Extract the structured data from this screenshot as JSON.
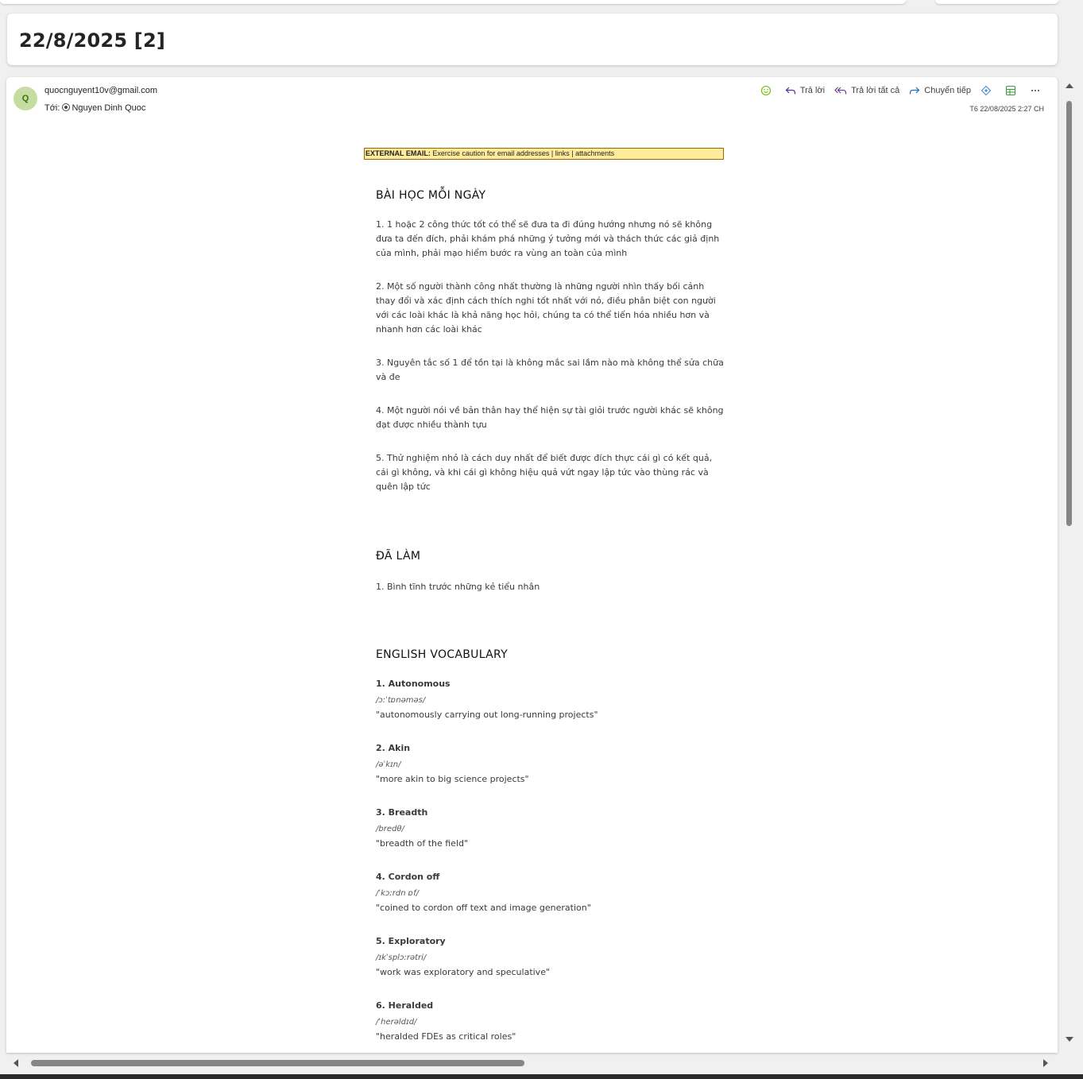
{
  "subject": "22/8/2025 [2]",
  "message": {
    "avatar_initial": "Q",
    "sender": "quocnguyent10v@gmail.com",
    "to_label": "Tới:",
    "to_name": "Nguyen Dinh Quoc",
    "timestamp": "T6 22/08/2025 2:27 CH",
    "actions": {
      "emoji_icon": "smiley-icon",
      "reply": "Trả lời",
      "reply_all": "Trả lời tất cả",
      "forward": "Chuyển tiếp"
    }
  },
  "body": {
    "banner_label": "EXTERNAL EMAIL:",
    "banner_text": " Exercise caution for email addresses | links | attachments",
    "lesson_heading": "BÀI HỌC MỖI NGÀY",
    "lessons": [
      "1. 1 hoặc 2 công thức tốt có thể sẽ đưa ta đi đúng hướng nhưng nó sẽ không đưa ta đến đích, phải khám phá những ý tưởng mới và thách thức các giả định của mình, phải mạo hiểm bước ra vùng an toàn của mình",
      "2. Một số người thành công nhất thường là những người nhìn thấy bối cảnh thay đổi và xác định cách thích nghi tốt nhất với nó, điều phân biệt con người với các loài khác là khả năng học hỏi, chúng ta có thể tiến hóa nhiều hơn và nhanh hơn các loài khác",
      "3. Nguyên tắc số 1 để tồn tại là không mắc sai lầm nào mà không thể sửa chữa và đe",
      "4. Một người nói về bản thân hay thể hiện sự tài giỏi trước người khác sẽ không đạt được nhiều thành tựu",
      "5. Thử nghiệm nhỏ là cách duy nhất để biết được đích thực cái gì có kết quả, cái gì không, và khi cái gì không hiệu quả vứt ngay lập tức vào thùng rác và quên lập tức"
    ],
    "done_heading": "ĐÃ LÀM",
    "done_items": [
      "1. Bình tĩnh trước những kẻ tiểu nhân"
    ],
    "vocab_heading": "ENGLISH VOCABULARY",
    "vocab": [
      {
        "word": "1. Autonomous",
        "ipa": "/ɔːˈtɒnəməs/",
        "example": "\"autonomously carrying out long-running projects\""
      },
      {
        "word": "2. Akin",
        "ipa": "/əˈkɪn/",
        "example": "\"more akin to big science projects\""
      },
      {
        "word": "3. Breadth",
        "ipa": "/bredθ/",
        "example": "\"breadth of the field\""
      },
      {
        "word": "4. Cordon off",
        "ipa": "/ˈkɔːrdn ɒf/",
        "example": "\"coined to cordon off text and image generation\""
      },
      {
        "word": "5. Exploratory",
        "ipa": "/ɪkˈsplɔːrətri/",
        "example": "\"work was exploratory and speculative\""
      },
      {
        "word": "6. Heralded",
        "ipa": "/ˈherəldɪd/",
        "example": "\"heralded FDEs as critical roles\""
      }
    ]
  },
  "colors": {
    "accent": "#5c2d91",
    "avatar_bg": "#c5dea0",
    "banner_bg": "#ffeb9c",
    "banner_border": "#9c6500"
  }
}
